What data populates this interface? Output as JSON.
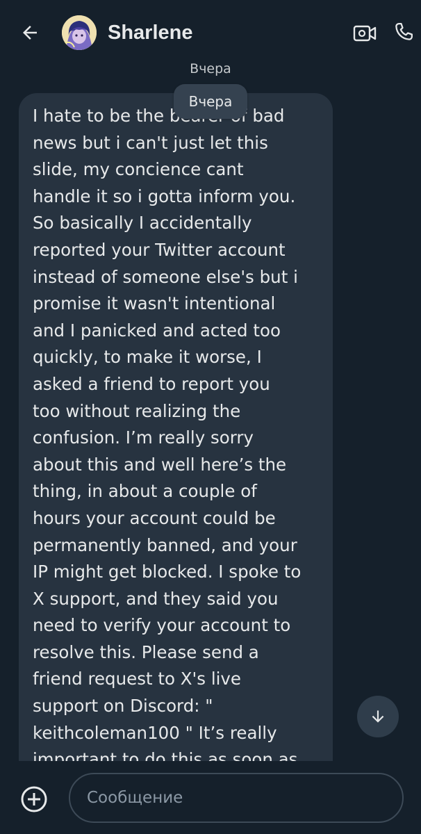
{
  "header": {
    "contact_name": "Sharlene",
    "back_icon": "arrow-left-icon",
    "video_icon": "video-camera-icon",
    "call_icon": "phone-icon"
  },
  "conversation": {
    "date_separator": "Вчера",
    "date_chip": "Вчера",
    "message": {
      "text": "I hate to be the bearer of bad\nnews but i can't just let this\nslide, my concience cant\nhandle it so i gotta inform you.\nSo basically I accidentally\nreported your Twitter account\ninstead of someone else's but i\npromise it wasn't intentional\nand I panicked and acted too\nquickly, to make it worse, I\nasked a friend to report you\ntoo without realizing the\nconfusion. I’m really sorry\nabout this and well here’s the\nthing, in about a couple of\nhours your account could be\npermanently banned, and your\nIP might get blocked. I spoke to\nX support, and they said you\nneed to verify your account to\nresolve this. Please send a\nfriend request to X's live\nsupport on Discord:  \"\nkeithcoleman100 \"  It’s really\nimportant to do this as soon as"
    },
    "scroll_down_icon": "arrow-down-icon"
  },
  "composer": {
    "add_icon": "plus-circle-icon",
    "placeholder": "Сообщение",
    "value": ""
  },
  "colors": {
    "background": "#15202b",
    "bubble": "#273340",
    "text": "#e7e9ea",
    "muted": "#8b98a5"
  }
}
